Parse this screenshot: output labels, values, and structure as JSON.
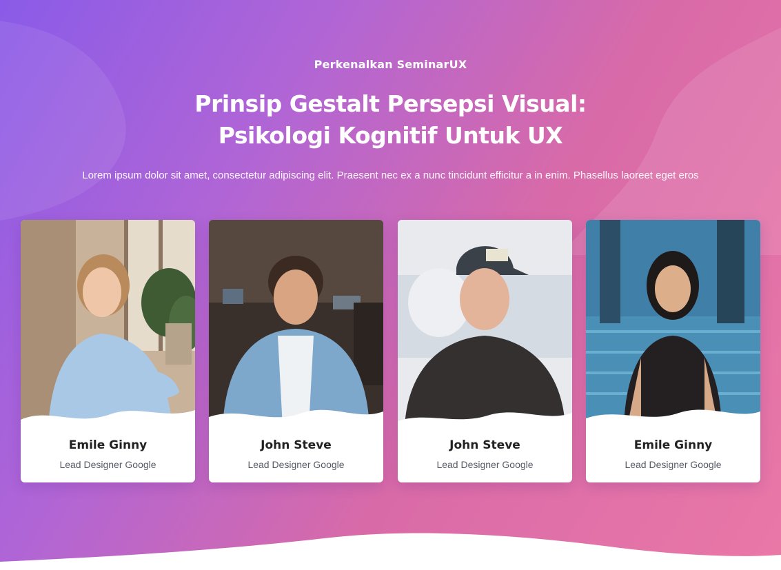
{
  "eyebrow": "Perkenalkan SeminarUX",
  "title": {
    "line1": "Prinsip Gestalt Persepsi Visual:",
    "line2": "Psikologi Kognitif Untuk UX"
  },
  "description": "Lorem ipsum dolor sit amet, consectetur adipiscing elit. Praesent nec ex a nunc tincidunt efficitur a in enim. Phasellus laoreet eget eros",
  "speakers": [
    {
      "name": "Emile Ginny",
      "role": "Lead Designer Google"
    },
    {
      "name": "John Steve",
      "role": "Lead Designer Google"
    },
    {
      "name": "John Steve",
      "role": "Lead Designer Google"
    },
    {
      "name": "Emile Ginny",
      "role": "Lead Designer Google"
    }
  ],
  "colors": {
    "gradient_start": "#8a5be8",
    "gradient_end": "#ea78a7",
    "card_bg": "#ffffff",
    "name_text": "#222222",
    "role_text": "#555a66"
  }
}
